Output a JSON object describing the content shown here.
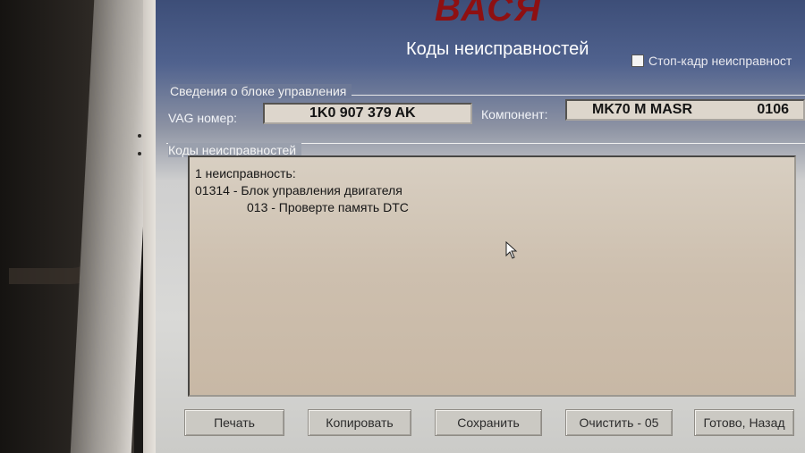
{
  "app": {
    "logo": "ВАСЯ",
    "title": "Коды неисправностей"
  },
  "freeze_frame": {
    "label": "Стоп-кадр неисправност",
    "checked": false
  },
  "control_unit": {
    "group_title": "Сведения о блоке управления",
    "vag_label": "VAG номер:",
    "vag_value": "1K0 907 379 AK",
    "component_label": "Компонент:",
    "component_value": "MK70 M MASR",
    "component_code": "0106"
  },
  "fault_codes": {
    "group_title": "Коды неисправностей",
    "lines": [
      "1 неисправность:",
      "01314 - Блок управления двигателя",
      "013 - Проверте память DTC"
    ]
  },
  "buttons": {
    "print": "Печать",
    "copy": "Копировать",
    "save": "Сохранить",
    "clear": "Очистить - 05",
    "done": "Готово, Назад"
  }
}
